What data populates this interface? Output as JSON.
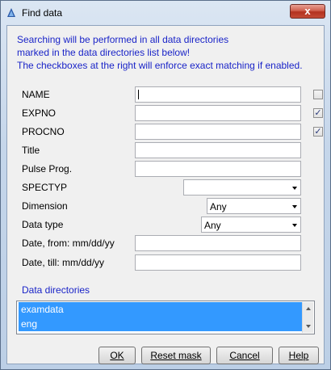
{
  "window": {
    "title": "Find data",
    "close_symbol": "x",
    "app_icon": "topspin-app-icon"
  },
  "info": {
    "line1": "Searching will be performed in all data directories",
    "line2": "marked in the data directories list below!",
    "line3": "The checkboxes at the right will enforce exact matching if enabled."
  },
  "fields": {
    "name": {
      "label": "NAME",
      "value": "",
      "exact_match": false
    },
    "expno": {
      "label": "EXPNO",
      "value": "",
      "exact_match": true
    },
    "procno": {
      "label": "PROCNO",
      "value": "",
      "exact_match": true
    },
    "title": {
      "label": "Title",
      "value": ""
    },
    "pulse_prog": {
      "label": "Pulse Prog.",
      "value": ""
    },
    "spectyp": {
      "label": "SPECTYP",
      "value": ""
    },
    "dimension": {
      "label": "Dimension",
      "value": "Any"
    },
    "data_type": {
      "label": "Data type",
      "value": "Any"
    },
    "date_from": {
      "label": "Date, from: mm/dd/yy",
      "value": ""
    },
    "date_till": {
      "label": "Date, till: mm/dd/yy",
      "value": ""
    }
  },
  "check_symbol": "✓",
  "data_directories": {
    "label": "Data directories",
    "items": [
      "examdata",
      "eng"
    ]
  },
  "buttons": {
    "ok": "OK",
    "reset": "Reset mask",
    "cancel": "Cancel",
    "help": "Help"
  },
  "colors": {
    "info_text": "#1a24c8",
    "selection": "#3399ff"
  }
}
